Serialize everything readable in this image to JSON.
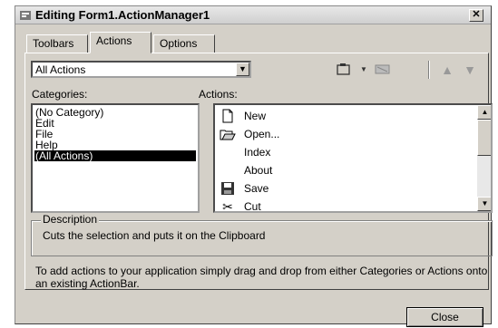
{
  "window": {
    "title": "Editing Form1.ActionManager1",
    "close_glyph": "✕"
  },
  "tabs": [
    {
      "label": "Toolbars"
    },
    {
      "label": "Actions"
    },
    {
      "label": "Options"
    }
  ],
  "filter": {
    "selected": "All Actions",
    "arrow": "▼"
  },
  "toolbar_icons": [
    "new-action-icon",
    "dropdown-arrow-icon",
    "delete-action-icon",
    "move-up-icon",
    "move-down-icon"
  ],
  "categories": {
    "label": "Categories:",
    "items": [
      "(No Category)",
      "Edit",
      "File",
      "Help",
      "(All Actions)"
    ],
    "selected_index": 4
  },
  "actions": {
    "label": "Actions:",
    "items": [
      {
        "label": "New",
        "icon": "new-document-icon"
      },
      {
        "label": "Open...",
        "icon": "open-folder-icon"
      },
      {
        "label": "Index",
        "icon": ""
      },
      {
        "label": "About",
        "icon": ""
      },
      {
        "label": "Save",
        "icon": "save-disk-icon"
      },
      {
        "label": "Cut",
        "icon": "scissors-icon"
      }
    ]
  },
  "description": {
    "legend": "Description",
    "text": "Cuts the selection and puts it on the Clipboard"
  },
  "help_text": "To add actions to your application simply drag and drop from either Categories or Actions onto an existing ActionBar.",
  "buttons": {
    "close": "Close"
  }
}
